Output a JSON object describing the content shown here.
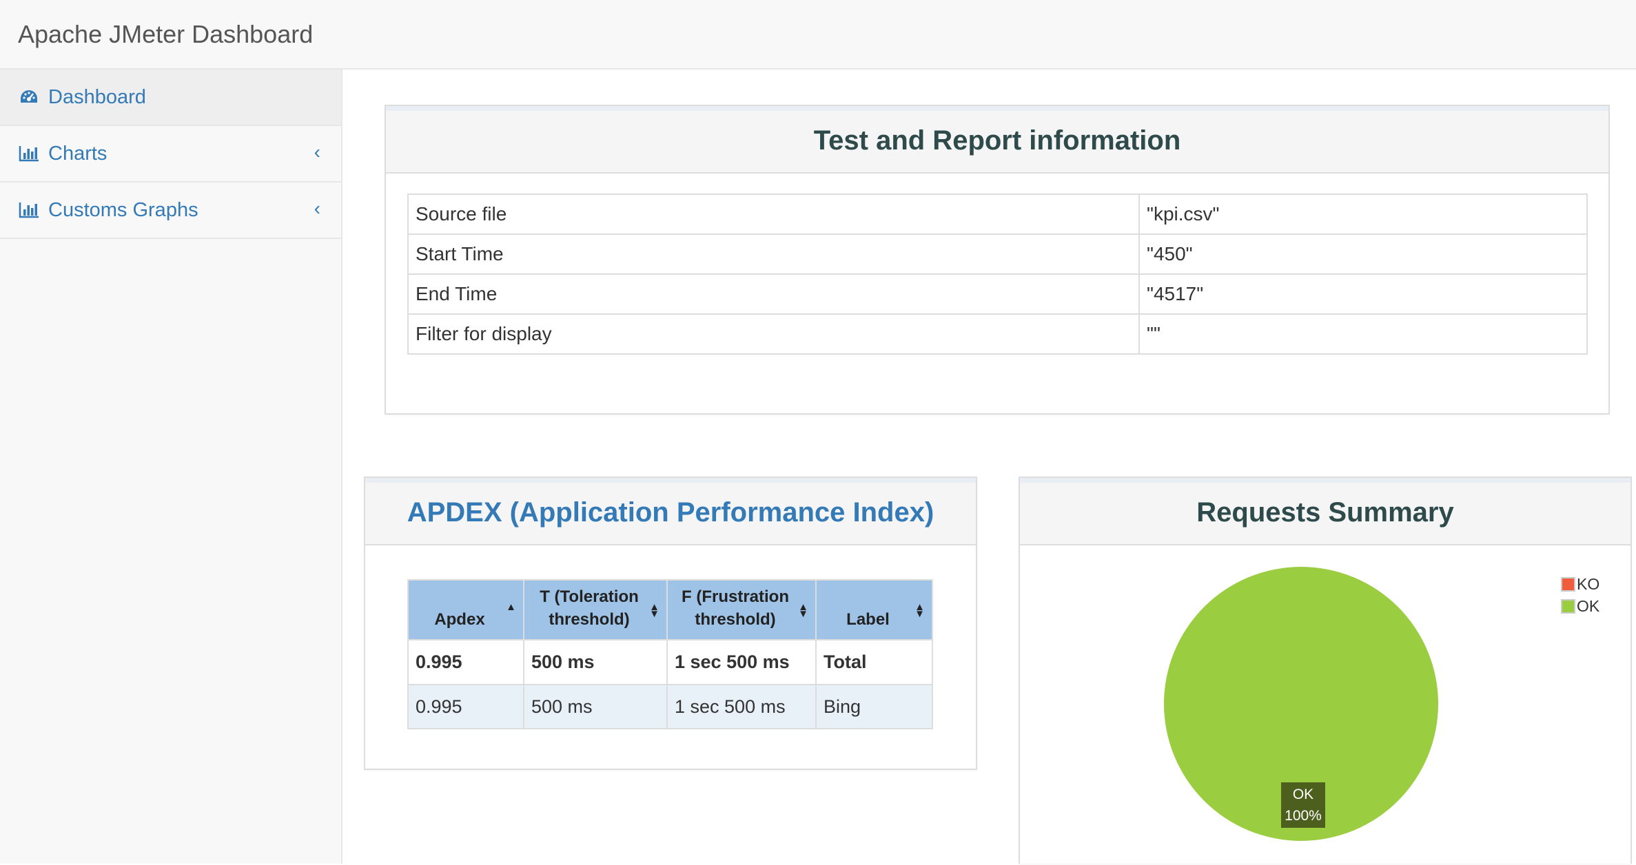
{
  "app": {
    "title": "Apache JMeter Dashboard"
  },
  "sidebar": {
    "items": [
      {
        "label": "Dashboard",
        "icon": "dashboard-icon",
        "active": true
      },
      {
        "label": "Charts",
        "icon": "bar-chart-icon",
        "expandable": true
      },
      {
        "label": "Customs Graphs",
        "icon": "bar-chart-icon",
        "expandable": true
      }
    ]
  },
  "info": {
    "title": "Test and Report information",
    "rows": [
      {
        "key": "Source file",
        "value": "\"kpi.csv\""
      },
      {
        "key": "Start Time",
        "value": "\"450\""
      },
      {
        "key": "End Time",
        "value": "\"4517\""
      },
      {
        "key": "Filter for display",
        "value": "\"\""
      }
    ]
  },
  "apdex": {
    "title": "APDEX (Application Performance Index)",
    "headers": [
      "Apdex",
      "T (Toleration threshold)",
      "F (Frustration threshold)",
      "Label"
    ],
    "total": [
      "0.995",
      "500 ms",
      "1 sec 500 ms",
      "Total"
    ],
    "rows": [
      [
        "0.995",
        "500 ms",
        "1 sec 500 ms",
        "Bing"
      ]
    ]
  },
  "summary": {
    "title": "Requests Summary",
    "legend": [
      {
        "label": "KO",
        "color": "#f05d3c"
      },
      {
        "label": "OK",
        "color": "#9acd3f"
      }
    ],
    "slice_label": {
      "name": "OK",
      "percent": "100%"
    }
  },
  "chart_data": {
    "type": "pie",
    "title": "Requests Summary",
    "categories": [
      "KO",
      "OK"
    ],
    "values": [
      0,
      100
    ],
    "colors": [
      "#f05d3c",
      "#9acd3f"
    ],
    "legend_position": "top-right"
  }
}
